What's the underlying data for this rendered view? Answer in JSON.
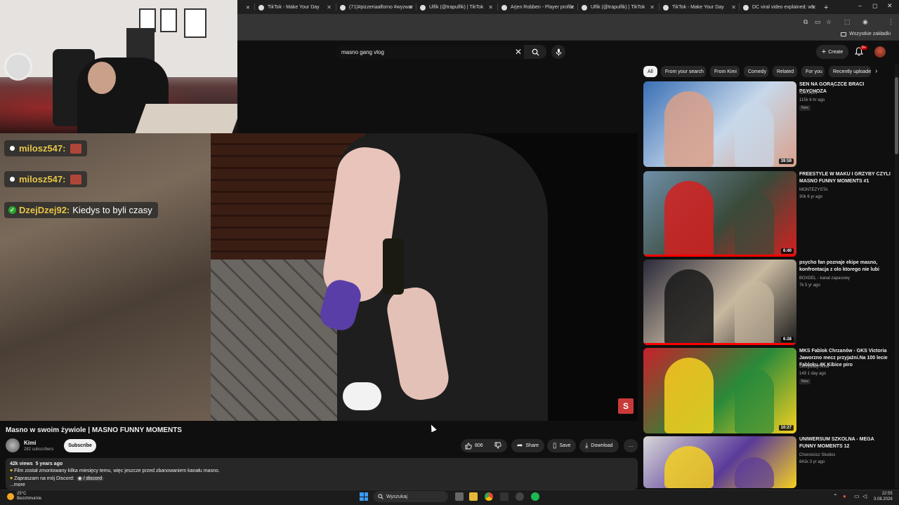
{
  "browser": {
    "tabs": [
      {
        "title": "TikTok - Make Your Day"
      },
      {
        "title": "(71)#pizzeriaalforno #wyzwan"
      },
      {
        "title": "Ulfik (@trapulfik) | TikTok"
      },
      {
        "title": "Arjen Robben - Player profile"
      },
      {
        "title": "Ulfik (@trapulfik) | TikTok"
      },
      {
        "title": "TikTok - Make Your Day"
      },
      {
        "title": "DC viral video explained: wh"
      }
    ],
    "new_tab": "+",
    "bookmarks_label": "Wszystkie zakładki",
    "window_controls": [
      "–",
      "◻",
      "✕"
    ]
  },
  "youtube": {
    "search": {
      "query": "masno gang vlog"
    },
    "create_label": "Create",
    "notifications_count": "9+",
    "chips": [
      "All",
      "From your search",
      "From Kimi",
      "Comedy",
      "Related",
      "For you",
      "Recently uploaded"
    ],
    "video": {
      "title": "Masno w swoim żywiole | MASNO FUNNY MOMENTS",
      "channel": "Kimi",
      "subscribers": "282 subscribers",
      "subscribe_label": "Subscribe",
      "likes": "806",
      "share_label": "Share",
      "save_label": "Save",
      "download_label": "Download",
      "more_label": "…",
      "watermark": "S",
      "views": "42k views",
      "age": "5 years ago",
      "desc_line1": "Film został zmontowany kilka miesięcy temu, więc jeszcze przed zbanowaniem kanału masno.",
      "desc_line2": "Zapraszam na mój Discord:",
      "desc_link": "/ discord",
      "desc_more": "...more"
    },
    "recommendations": [
      {
        "title": "SEN NA GORĄCZCE BRACI PSYCHOZA",
        "channel": "SAYGON",
        "meta": "115k  6 hr ago",
        "badge": "New",
        "duration": "39:59",
        "progress": 0,
        "thumb_colors": [
          "#3a6fb5",
          "#c7d8ea",
          "#d9a08a"
        ]
      },
      {
        "title": "FREESTYLE W MAKU I GRZYBY CZYLI MASNO FUNNY MOMENTS #1",
        "channel": "MONTEZYSTA",
        "meta": "30k  6 yr ago",
        "badge": "",
        "duration": "6:40",
        "progress": 1.0,
        "thumb_colors": [
          "#6f8fa8",
          "#3a4a3a",
          "#d42020"
        ]
      },
      {
        "title": "psycho fan poznaje ekipe masno, konfrontacja z olo ktorego nie lubi",
        "channel": "BOXDEL - kanał zapasowy",
        "meta": "7k  5 yr ago",
        "badge": "",
        "duration": "6:28",
        "progress": 1.0,
        "thumb_colors": [
          "#2a2a3a",
          "#c8b8a0",
          "#1a1a1a"
        ]
      },
      {
        "title": "MKS Fablok Chrzanów - GKS Victoria Jaworzno mecz przyjaźni.Na 100 lecie Fabloku.4K Kibice piro",
        "channel": "Skrzydlaty Anioł",
        "meta": "149  1 day ago",
        "badge": "New",
        "duration": "10:27",
        "progress": 0,
        "thumb_colors": [
          "#c8202a",
          "#2a8a3a",
          "#f5d020"
        ]
      },
      {
        "title": "UNIWERSUM SZKOLNA - MEGA FUNNY MOMENTS 12",
        "channel": "Chorościcz Studios",
        "meta": "841k  3 yr ago",
        "badge": "",
        "duration": "",
        "progress": 0,
        "thumb_colors": [
          "#d8d8d8",
          "#5a3a9a",
          "#f5d020"
        ]
      }
    ]
  },
  "stream_chat": [
    {
      "user": "milosz547",
      "message": "",
      "emote": true,
      "verified": false
    },
    {
      "user": "milosz547",
      "message": "",
      "emote": true,
      "verified": false
    },
    {
      "user": "DzejDzej92",
      "message": "Kiedys to byli czasy",
      "emote": false,
      "verified": true
    }
  ],
  "taskbar": {
    "weather_temp": "25°C",
    "weather_desc": "Bezchmurnie",
    "search_placeholder": "Wyszukaj",
    "time": "22:55",
    "date": "3.08.2026"
  }
}
